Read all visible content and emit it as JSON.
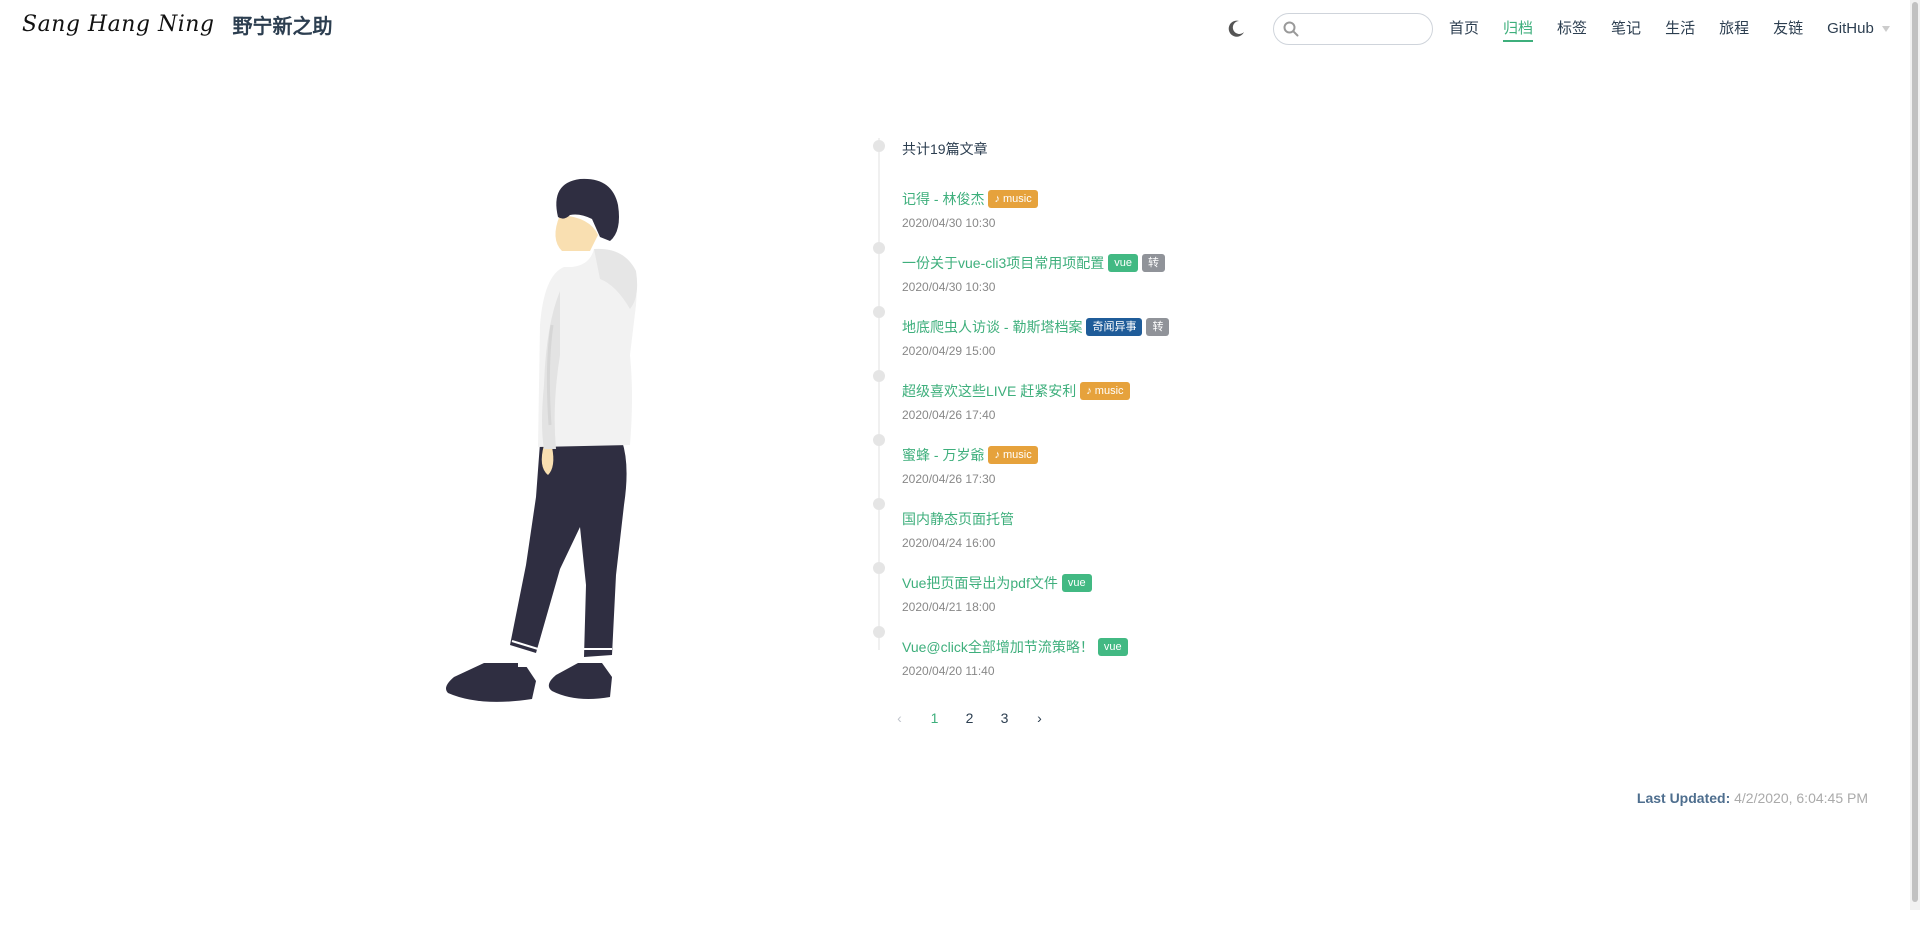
{
  "brand": {
    "logo_text": "Sang Hang Ning",
    "title": "野宁新之助"
  },
  "search": {
    "placeholder": "",
    "value": ""
  },
  "nav": {
    "items": [
      {
        "label": "首页",
        "active": false
      },
      {
        "label": "归档",
        "active": true
      },
      {
        "label": "标签",
        "active": false
      },
      {
        "label": "笔记",
        "active": false
      },
      {
        "label": "生活",
        "active": false
      },
      {
        "label": "旅程",
        "active": false
      },
      {
        "label": "友链",
        "active": false
      }
    ],
    "dropdown_label": "GitHub"
  },
  "archive": {
    "count_label": "共计19篇文章",
    "posts": [
      {
        "title": "记得 - 林俊杰",
        "date": "2020/04/30 10:30",
        "tags": [
          {
            "label": "♪ music",
            "color": "#e6a23c"
          }
        ]
      },
      {
        "title": "一份关于vue-cli3项目常用项配置",
        "date": "2020/04/30 10:30",
        "tags": [
          {
            "label": "vue",
            "color": "#42b983"
          },
          {
            "label": "转",
            "color": "#909399"
          }
        ]
      },
      {
        "title": "地底爬虫人访谈 - 勒斯塔档案",
        "date": "2020/04/29 15:00",
        "tags": [
          {
            "label": "奇闻异事",
            "color": "#1f5c99"
          },
          {
            "label": "转",
            "color": "#909399"
          }
        ]
      },
      {
        "title": "超级喜欢这些LIVE 赶紧安利",
        "date": "2020/04/26 17:40",
        "tags": [
          {
            "label": "♪ music",
            "color": "#e6a23c"
          }
        ]
      },
      {
        "title": "蜜蜂 - 万岁爺",
        "date": "2020/04/26 17:30",
        "tags": [
          {
            "label": "♪ music",
            "color": "#e6a23c"
          }
        ]
      },
      {
        "title": "国内静态页面托管",
        "date": "2020/04/24 16:00",
        "tags": []
      },
      {
        "title": "Vue把页面导出为pdf文件",
        "date": "2020/04/21 18:00",
        "tags": [
          {
            "label": "vue",
            "color": "#42b983"
          }
        ]
      },
      {
        "title": "Vue@click全部增加节流策略！",
        "date": "2020/04/20 11:40",
        "tags": [
          {
            "label": "vue",
            "color": "#42b983"
          }
        ]
      }
    ]
  },
  "pagination": {
    "prev": "‹",
    "next": "›",
    "pages": [
      "1",
      "2",
      "3"
    ],
    "current": "1"
  },
  "footer": {
    "last_updated_label": "Last Updated:",
    "last_updated_value": "4/2/2020, 6:04:45 PM"
  },
  "colors": {
    "accent": "#3eaf7c",
    "text": "#2c3e50",
    "muted": "#888888"
  },
  "icons": {
    "theme": "moon-icon",
    "search": "search-icon",
    "caret": "chevron-down-icon"
  }
}
